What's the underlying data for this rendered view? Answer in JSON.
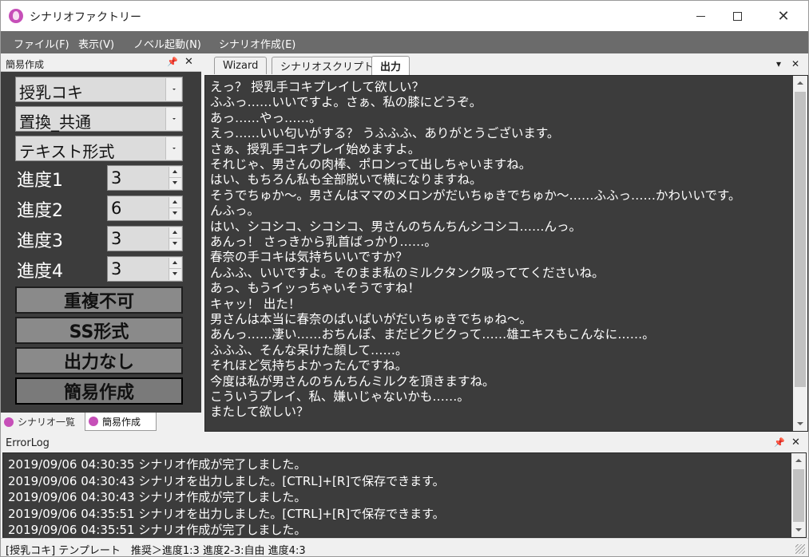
{
  "window": {
    "title": "シナリオファクトリー"
  },
  "menu": [
    "ファイル(F)",
    "表示(V)",
    "ノベル起動(N)",
    "シナリオ作成(E)"
  ],
  "left_panel": {
    "title": "簡易作成",
    "combos": [
      "授乳コキ",
      "置換_共通",
      "テキスト形式"
    ],
    "progress": [
      {
        "label": "進度1",
        "value": "3"
      },
      {
        "label": "進度2",
        "value": "6"
      },
      {
        "label": "進度3",
        "value": "3"
      },
      {
        "label": "進度4",
        "value": "3"
      }
    ],
    "buttons": [
      "重複不可",
      "SS形式",
      "出力なし",
      "簡易作成"
    ],
    "tabs": [
      "シナリオ一覧",
      "簡易作成"
    ]
  },
  "right_panel": {
    "tabs": [
      "Wizard",
      "シナリオスクリプト",
      "出力"
    ],
    "output_lines": [
      "えっ？ 授乳手コキプレイして欲しい？",
      "ふふっ……いいですよ。さぁ、私の膝にどうぞ。",
      "あっ……やっ……。",
      "えっ……いい匂いがする？ うふふふ、ありがとうございます。",
      "さぁ、授乳手コキプレイ始めますよ。",
      "それじゃ、男さんの肉棒、ポロンって出しちゃいますね。",
      "はい、もちろん私も全部脱いで横になりますね。",
      "そうでちゅか～。男さんはママのメロンがだいちゅきでちゅか～……ふふっ……かわいいです。",
      "んふっ。",
      "はい、シコシコ、シコシコ、男さんのちんちんシコシコ……んっ。",
      "あんっ！ さっきから乳首ばっかり……。",
      "春奈の手コキは気持ちいいですか？",
      "んふふ、いいですよ。そのまま私のミルクタンク吸っててくださいね。",
      "あっ、もうイッっちゃいそうですね！",
      "キャッ！ 出た！",
      "男さんは本当に春奈のぱいぱいがだいちゅきでちゅね～。",
      "あんっ……凄い……おちんぽ、まだビクビクって……雄エキスもこんなに……。",
      "ふふふ、そんな呆けた顔して……。",
      "それほど気持ちよかったんですね。",
      "今度は私が男さんのちんちんミルクを頂きますね。",
      "こういうプレイ、私、嫌いじゃないかも……。",
      "またして欲しい？"
    ]
  },
  "error_log": {
    "title": "ErrorLog",
    "lines": [
      "2019/09/06 04:30:35 シナリオ作成が完了しました。",
      "2019/09/06 04:30:43 シナリオを出力しました。[CTRL]+[R]で保存できます。",
      "2019/09/06 04:30:43 シナリオ作成が完了しました。",
      "2019/09/06 04:35:51 シナリオを出力しました。[CTRL]+[R]で保存できます。",
      "2019/09/06 04:35:51 シナリオ作成が完了しました。"
    ]
  },
  "status_bar": {
    "text": "[授乳コキ] テンプレート　推奨＞進度1:3 進度2-3:自由 進度4:3"
  },
  "colors": {
    "panel_bg": "#3c3c3c",
    "menu_bg": "#6b6b6b",
    "button_bg": "#8a8a8a",
    "text_light": "#ffffff"
  }
}
